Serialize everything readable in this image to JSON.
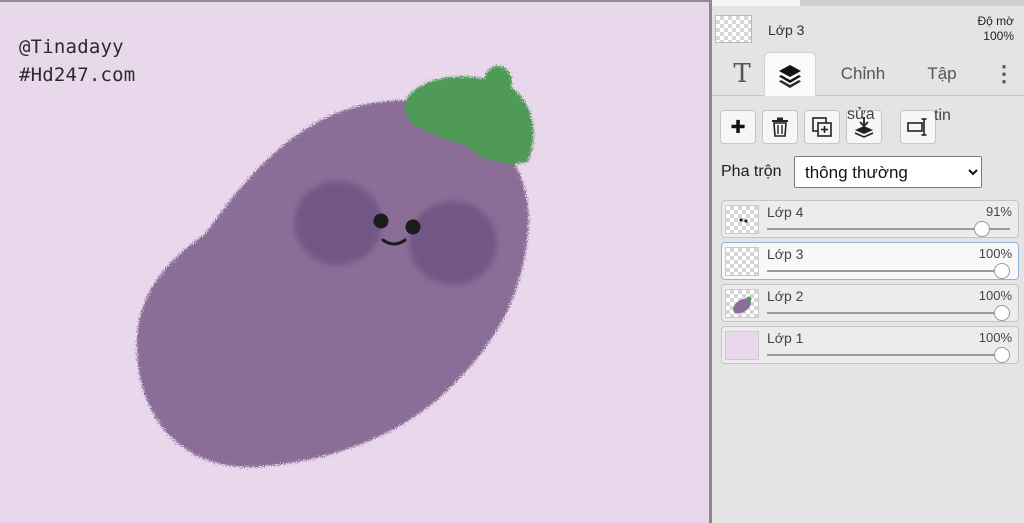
{
  "canvas": {
    "watermark_line1": "@Tinadayy",
    "watermark_line2": "#Hd247.com",
    "background_color": "#e9d8ec",
    "subject": "eggplant character"
  },
  "panel": {
    "active_layer_name": "Lớp 3",
    "opacity_label": "Độ mờ",
    "opacity_value": "100%",
    "tabs": [
      {
        "icon": "text-icon",
        "label": "T"
      },
      {
        "icon": "layers-icon",
        "label": ""
      },
      {
        "label": "Chỉnh"
      },
      {
        "label": "Tập"
      },
      {
        "icon": "more-vertical-icon",
        "label": "⋮"
      }
    ],
    "toolbar": {
      "add_label": "✚",
      "overflow_text_1": "sửa",
      "overflow_text_2": "tin",
      "icons": [
        "add-layer-icon",
        "delete-layer-icon",
        "duplicate-layer-icon",
        "merge-down-icon",
        "rename-layer-icon"
      ]
    },
    "blend": {
      "label": "Pha trộn",
      "selected": "thông thường"
    },
    "layers": [
      {
        "name": "Lớp 4",
        "opacity": "91%",
        "level": 0.91,
        "active": false
      },
      {
        "name": "Lớp 3",
        "opacity": "100%",
        "level": 1.0,
        "active": true
      },
      {
        "name": "Lớp 2",
        "opacity": "100%",
        "level": 1.0,
        "active": false
      },
      {
        "name": "Lớp 1",
        "opacity": "100%",
        "level": 1.0,
        "active": false
      }
    ]
  },
  "colors": {
    "eggplant": "#8a6e98",
    "cheek": "#6f5482",
    "cap": "#4f9a57",
    "active_row_border": "#8fb4e0"
  }
}
